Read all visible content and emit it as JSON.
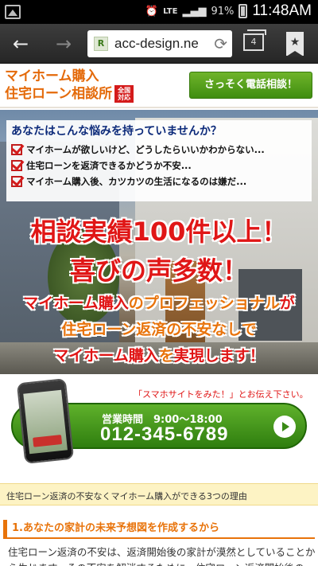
{
  "status_bar": {
    "network": "LTE",
    "battery": "91%",
    "time": "11:48AM"
  },
  "browser": {
    "url": "acc-design.ne",
    "favicon_letter": "R",
    "tab_count": "4",
    "bookmark_glyph": "★"
  },
  "header": {
    "logo_line1": "マイホーム購入",
    "logo_line2": "住宅ローン相談所",
    "logo_badge": "全国対応",
    "call_button": "さっそく電話相談！"
  },
  "hero": {
    "question": "あなたはこんな悩みを持っていませんか？",
    "worries": [
      "マイホームが欲しいけど、どうしたらいいかわからない...",
      "住宅ローンを返済できるかどうか不安...",
      "マイホーム購入後、カツカツの生活になるのは嫌だ..."
    ],
    "headline1": "相談実績100件以上！",
    "headline2": "喜びの声多数！",
    "sub1_a": "マイホーム購入",
    "sub1_b": "のプロフェッショナル",
    "sub1_c": "が",
    "sub2": "住宅ローン返済の不安なしで",
    "sub3_a": "マイホーム購入",
    "sub3_b": "を",
    "sub3_c": "実現します！"
  },
  "cta": {
    "note": "「スマホサイトをみた！」とお伝え下さい。",
    "hours": "営業時間　9:00〜18:00",
    "tel": "012-345-6789"
  },
  "reasons": {
    "bar_title": "住宅ローン返済の不安なくマイホーム購入ができる3つの理由",
    "reason1_title": "1.あなたの家計の未来予想図を作成するから",
    "reason1_text": "住宅ローン返済の不安は、返済開始後の家計が漠然としていることから生じます。その不安を解消するために、住宅ローン返済開始後の"
  },
  "colors": {
    "accent_orange": "#e8730a",
    "headline_red": "#e01616",
    "cta_green": "#3f8d10"
  }
}
